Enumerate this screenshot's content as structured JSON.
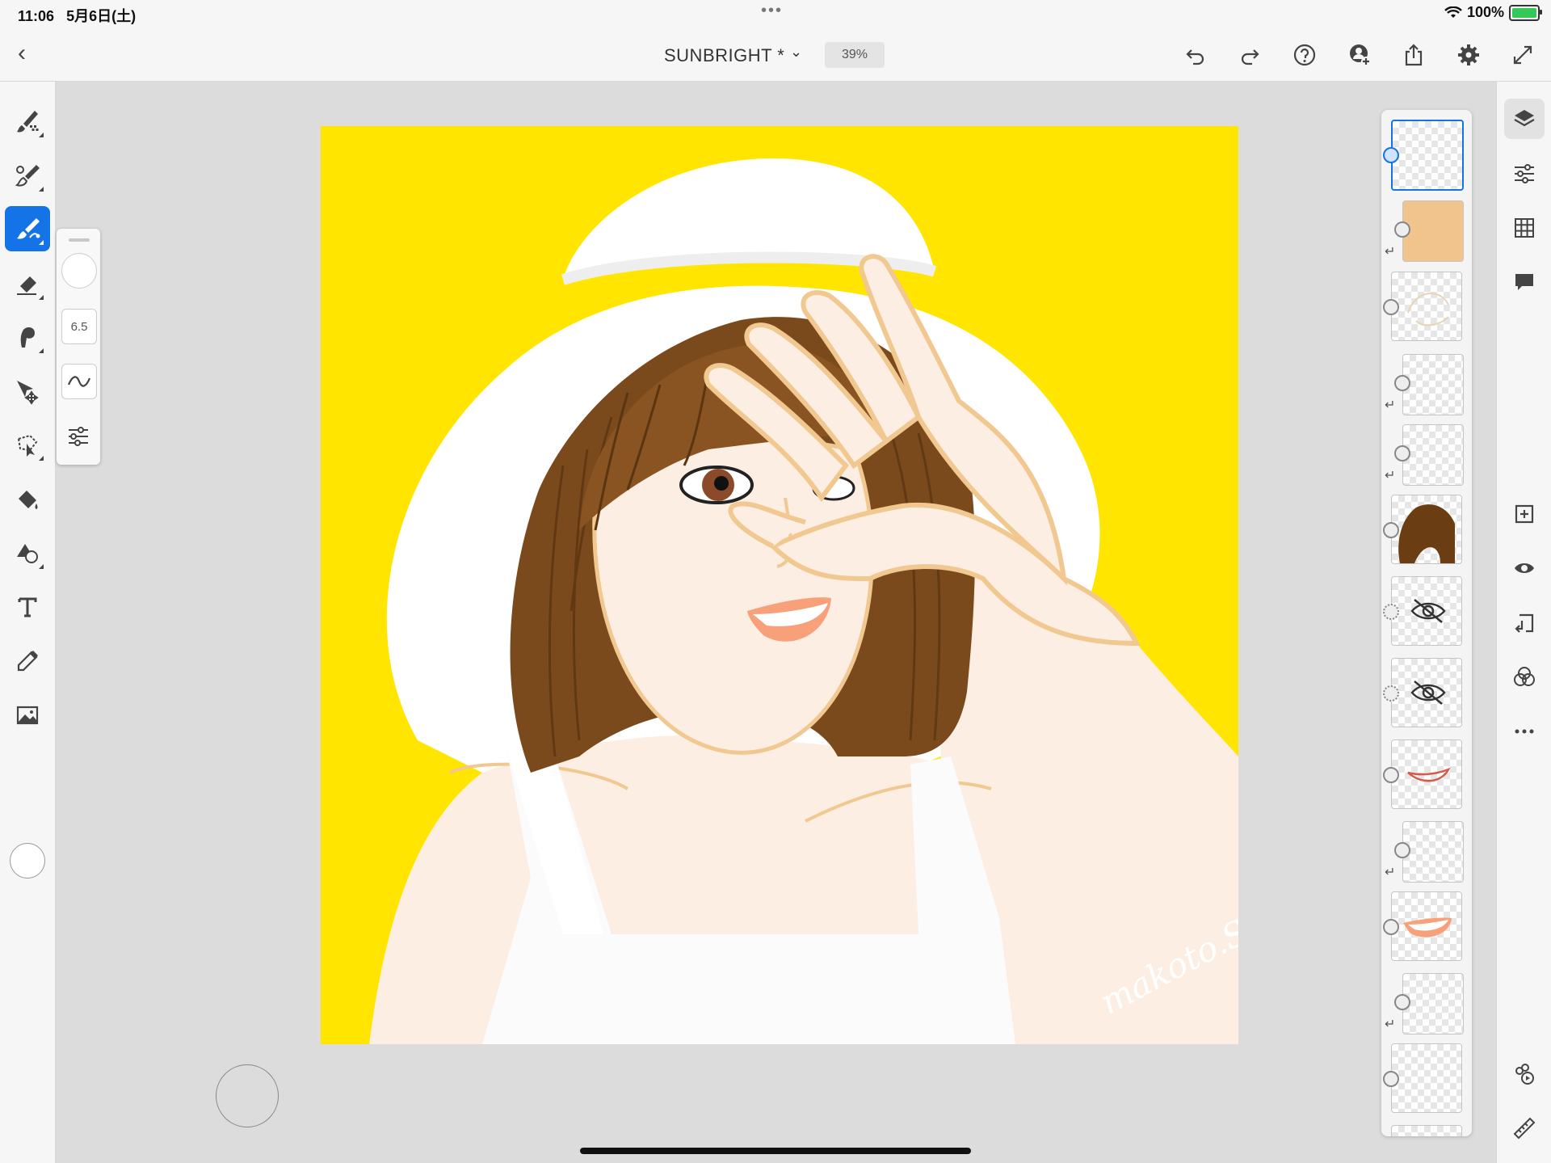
{
  "status_bar": {
    "time": "11:06",
    "date": "5月6日(土)",
    "battery_pct": "100%"
  },
  "toolbar": {
    "back_icon": "chevron-left-icon",
    "doc_title": "SUNBRIGHT *",
    "zoom": "39%",
    "right_icons": [
      "undo-icon",
      "redo-icon",
      "help-icon",
      "invite-user-icon",
      "share-icon",
      "settings-icon",
      "fullscreen-icon"
    ]
  },
  "tools": [
    {
      "name": "pixel-brush-tool",
      "icon": "pixel-brush-icon"
    },
    {
      "name": "live-brush-tool",
      "icon": "live-brush-icon"
    },
    {
      "name": "vector-brush-tool",
      "icon": "vector-brush-icon",
      "active": true
    },
    {
      "name": "eraser-tool",
      "icon": "eraser-icon"
    },
    {
      "name": "smudge-tool",
      "icon": "smudge-icon"
    },
    {
      "name": "transform-tool",
      "icon": "move-icon"
    },
    {
      "name": "selection-tool",
      "icon": "lasso-icon"
    },
    {
      "name": "fill-tool",
      "icon": "paint-bucket-icon"
    },
    {
      "name": "shape-tool",
      "icon": "shapes-icon"
    },
    {
      "name": "text-tool",
      "icon": "text-icon"
    },
    {
      "name": "eyedropper-tool",
      "icon": "eyedropper-icon"
    },
    {
      "name": "image-tool",
      "icon": "image-icon"
    }
  ],
  "brush_panel": {
    "size": "6.5",
    "icons": [
      "brush-tip-icon",
      "smoothing-icon",
      "brush-settings-icon"
    ]
  },
  "canvas": {
    "signature": "makoto.S",
    "background_color": "#ffe500"
  },
  "layers": {
    "count_visible": 14,
    "hidden_icon": "eye-hidden-icon",
    "items": [
      "empty-selected",
      "skin-fill-clipped",
      "sketch",
      "empty-clipped",
      "highlight-clipped",
      "hair",
      "hidden-sketch-1",
      "hidden-sketch-2",
      "lip-line",
      "empty-clipped-2",
      "lips-fill",
      "empty-clipped-3",
      "empty",
      "partial"
    ]
  },
  "right_panel_icons": [
    "layers-icon",
    "layer-properties-icon",
    "grid-icon",
    "comments-icon",
    "add-layer-icon",
    "visibility-icon",
    "merge-down-icon",
    "blend-icon",
    "more-icon",
    "timelapse-icon",
    "ruler-icon"
  ]
}
